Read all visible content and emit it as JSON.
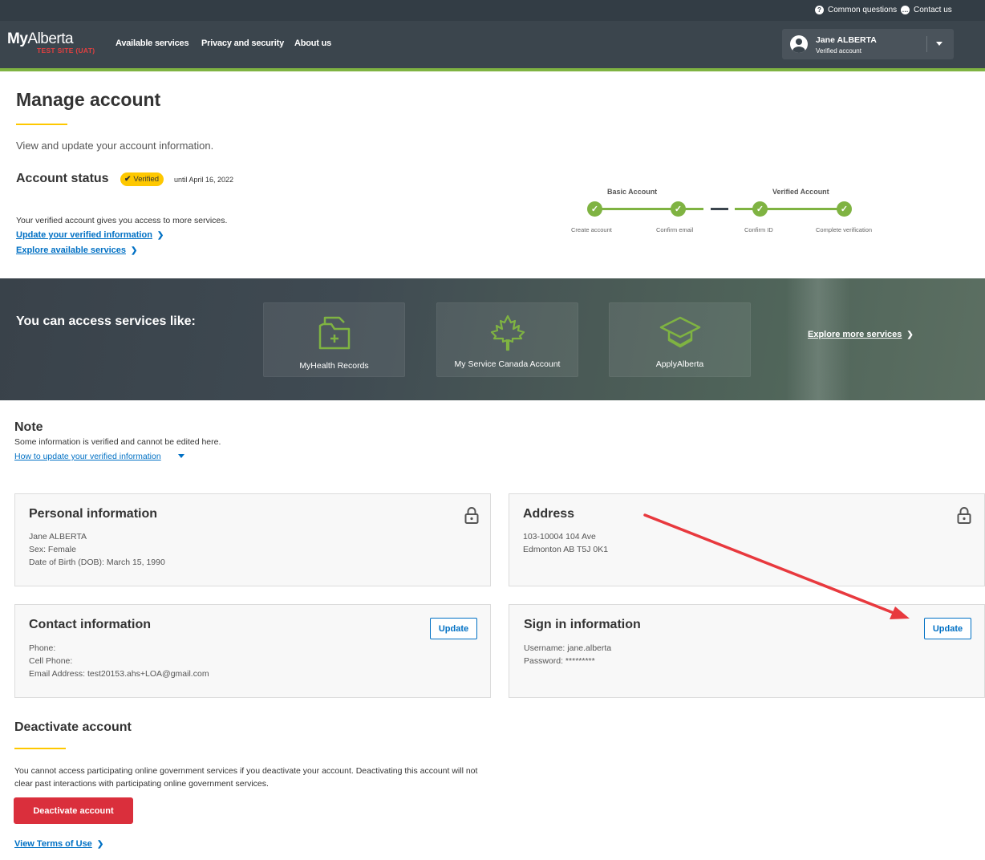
{
  "utility_bar": {
    "common_questions": "Common questions",
    "contact_us": "Contact us"
  },
  "header": {
    "logo_my": "My",
    "logo_alberta": "Alberta",
    "logo_sub": "TEST SITE (UAT)",
    "nav": [
      "Available services",
      "Privacy and security",
      "About us"
    ],
    "user_name": "Jane ALBERTA",
    "user_status": "Verified account"
  },
  "page": {
    "title": "Manage account",
    "intro": "View and update your account information."
  },
  "account_status": {
    "heading": "Account status",
    "badge": "Verified",
    "until": "until April 16, 2022",
    "description": "Your verified account gives you access to more services.",
    "link_update": "Update your verified information",
    "link_explore": "Explore available services"
  },
  "stepper": {
    "group_basic": "Basic Account",
    "group_verified": "Verified Account",
    "steps": [
      "Create account",
      "Confirm email",
      "Confirm ID",
      "Complete verification"
    ],
    "completed": 4
  },
  "banner": {
    "title": "You can access services like:",
    "services": [
      "MyHealth Records",
      "My Service Canada Account",
      "ApplyAlberta"
    ],
    "explore_link": "Explore more services"
  },
  "note": {
    "title": "Note",
    "text": "Some information is verified and cannot be edited here.",
    "link": "How to update your verified information"
  },
  "cards": {
    "personal": {
      "title": "Personal information",
      "lines": [
        "Jane ALBERTA",
        "Sex: Female",
        "Date of Birth (DOB): March 15, 1990"
      ]
    },
    "address": {
      "title": "Address",
      "lines": [
        "103-10004 104 Ave",
        "Edmonton AB T5J 0K1"
      ]
    },
    "contact": {
      "title": "Contact information",
      "button": "Update",
      "lines": [
        "Phone:",
        "Cell Phone:",
        "Email Address: test20153.ahs+LOA@gmail.com"
      ]
    },
    "signin": {
      "title": "Sign in information",
      "button": "Update",
      "lines": [
        "Username: jane.alberta",
        "Password: *********"
      ]
    }
  },
  "deactivate": {
    "title": "Deactivate account",
    "text": "You cannot access participating online government services if you deactivate your account. Deactivating this account will not clear past interactions with participating online government services.",
    "button": "Deactivate account",
    "terms_link": "View Terms of Use"
  },
  "colors": {
    "header_bg": "#3b454d",
    "utility_bg": "#333d45",
    "brand_green": "#7fb342",
    "accent_yellow": "#fec800",
    "link_blue": "#0070c4",
    "danger_red": "#da2f3c",
    "annotation_arrow": "#e8393e"
  }
}
